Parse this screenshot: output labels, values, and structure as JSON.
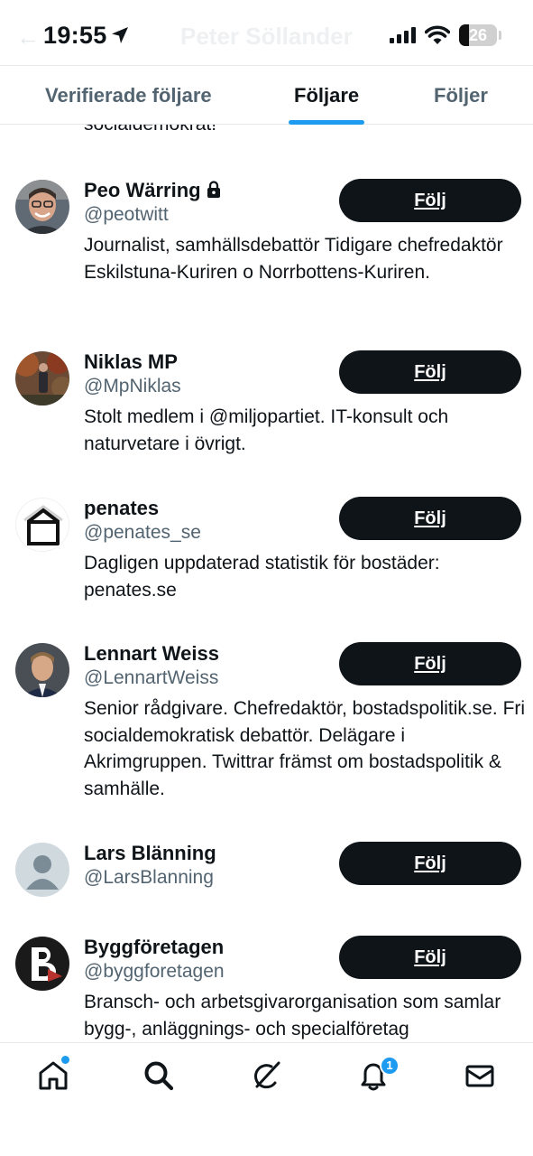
{
  "status_bar": {
    "time": "19:55",
    "battery": "26"
  },
  "header": {
    "title": "Peter Söllander"
  },
  "tabs": [
    {
      "label": "Verifierade följare",
      "active": false
    },
    {
      "label": "Följare",
      "active": true
    },
    {
      "label": "Följer",
      "active": false
    }
  ],
  "list": {
    "previous_bio_tail": "socialdemokrat!",
    "users": [
      {
        "name": "Peo Wärring",
        "handle": "@peotwitt",
        "protected": true,
        "bio": "Journalist, samhällsdebattör Tidigare chefredaktör Eskilstuna-Kuriren o Norrbottens-Kuriren.",
        "button": "Följ",
        "avatar_icon": "profile-photo"
      },
      {
        "name": "Niklas MP",
        "handle": "@MpNiklas",
        "protected": false,
        "bio": "Stolt medlem i @miljopartiet. IT-konsult och naturvetare i övrigt.",
        "button": "Följ",
        "avatar_icon": "profile-photo"
      },
      {
        "name": "penates",
        "handle": "@penates_se",
        "protected": false,
        "bio": "Dagligen uppdaterad statistik för bostäder: penates.se",
        "button": "Följ",
        "avatar_icon": "house-logo"
      },
      {
        "name": "Lennart Weiss",
        "handle": "@LennartWeiss",
        "protected": false,
        "bio": "Senior rådgivare. Chefredaktör, bostadspolitik.se. Fri socialdemokratisk debattör. Delägare i Akrimgruppen. Twittrar främst om bostadspolitik & samhälle.",
        "button": "Följ",
        "avatar_icon": "profile-photo"
      },
      {
        "name": "Lars Blänning",
        "handle": "@LarsBlanning",
        "protected": false,
        "bio": "",
        "button": "Följ",
        "avatar_icon": "default-avatar"
      },
      {
        "name": "Byggföretagen",
        "handle": "@byggforetagen",
        "protected": false,
        "bio": "Bransch- och arbetsgivarorganisation som samlar bygg-, anläggnings- och specialföretag",
        "button": "Följ",
        "avatar_icon": "b-logo"
      }
    ]
  },
  "bottom_nav": {
    "items": [
      {
        "icon": "home-icon",
        "has_dot": true
      },
      {
        "icon": "search-icon"
      },
      {
        "icon": "grok-icon"
      },
      {
        "icon": "bell-icon",
        "badge": "1"
      },
      {
        "icon": "mail-icon"
      }
    ]
  },
  "colors": {
    "accent": "#1d9bf0",
    "text": "#0f1419",
    "secondary_text": "#536471",
    "button_bg": "#0f1419"
  }
}
